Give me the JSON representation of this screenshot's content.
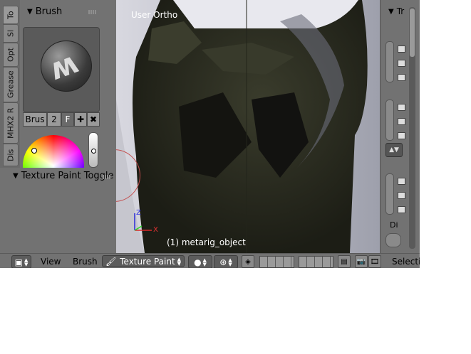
{
  "vertical_tabs": [
    "To",
    "Sl",
    "Opt",
    "Grease",
    "MHX2 R",
    "Dis"
  ],
  "brush_panel": {
    "title": "Brush",
    "brush_name": "Brus",
    "users": "2",
    "fake_user": "F",
    "add_icon": "plus-icon",
    "remove_icon": "close-icon"
  },
  "texture_panel": {
    "title": "Texture Paint Toggle"
  },
  "viewport": {
    "view_label": "User Ortho",
    "object_label": "(1) metarig_object",
    "axis_z": "Z",
    "axis_x": "X"
  },
  "properties": {
    "title": "Tr",
    "label_di": "Di"
  },
  "header": {
    "view_menu": "View",
    "brush_menu": "Brush",
    "mode": "Texture Paint",
    "selection": "Selectio"
  },
  "colors": {
    "panel_bg": "#727272",
    "viewport_bg": "#bdbdc4",
    "mesh_dark": "#2c2e22"
  }
}
